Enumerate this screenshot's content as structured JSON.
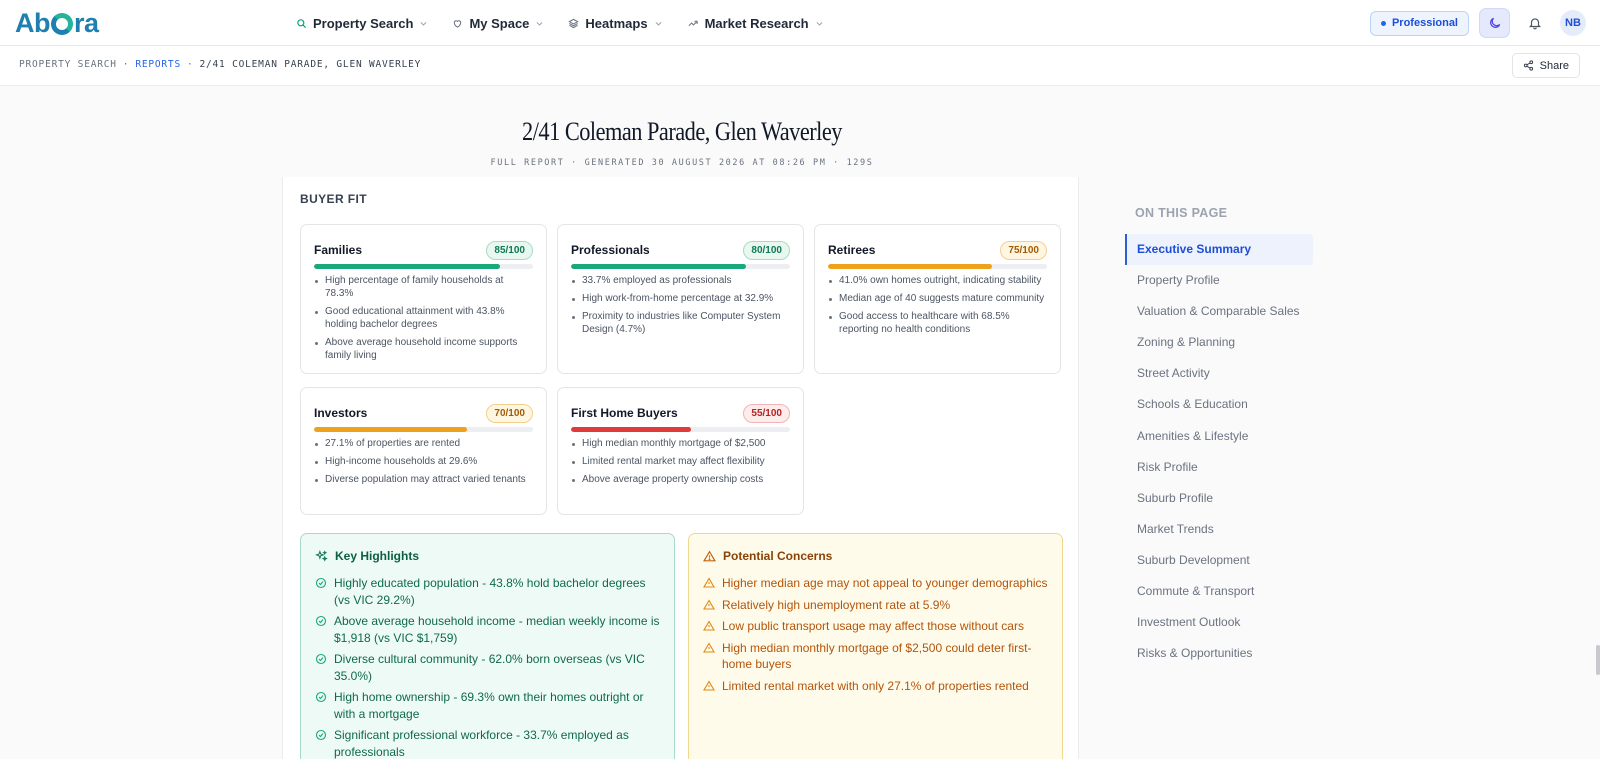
{
  "app": {
    "logo": [
      "Ab",
      "ra"
    ]
  },
  "nav": [
    {
      "label": "Property Search",
      "icon": "search-icon"
    },
    {
      "label": "My Space",
      "icon": "heart-icon"
    },
    {
      "label": "Heatmaps",
      "icon": "layers-icon"
    },
    {
      "label": "Market Research",
      "icon": "trending-icon"
    }
  ],
  "header": {
    "plan": "Professional",
    "avatar": "NB"
  },
  "breadcrumb": {
    "root": "PROPERTY SEARCH",
    "sep": "·",
    "reports": "REPORTS",
    "current": "2/41 COLEMAN PARADE, GLEN WAVERLEY"
  },
  "share_label": "Share",
  "report": {
    "title": "2/41 Coleman Parade, Glen Waverley",
    "subtitle": "FULL REPORT · GENERATED 30 AUGUST 2026 AT 08:26 PM · 129S"
  },
  "buyer_fit": {
    "title": "BUYER FIT",
    "cards": [
      {
        "name": "Families",
        "score": "85/100",
        "fraction": 0.85,
        "tone": "green",
        "points": [
          "High percentage of family households at 78.3%",
          "Good educational attainment with 43.8% holding bachelor degrees",
          "Above average household income supports family living"
        ]
      },
      {
        "name": "Professionals",
        "score": "80/100",
        "fraction": 0.8,
        "tone": "green",
        "points": [
          "33.7% employed as professionals",
          "High work-from-home percentage at 32.9%",
          "Proximity to industries like Computer System Design (4.7%)"
        ]
      },
      {
        "name": "Retirees",
        "score": "75/100",
        "fraction": 0.75,
        "tone": "amber",
        "points": [
          "41.0% own homes outright, indicating stability",
          "Median age of 40 suggests mature community",
          "Good access to healthcare with 68.5% reporting no health conditions"
        ]
      },
      {
        "name": "Investors",
        "score": "70/100",
        "fraction": 0.7,
        "tone": "amber",
        "points": [
          "27.1% of properties are rented",
          "High-income households at 29.6%",
          "Diverse population may attract varied tenants"
        ]
      },
      {
        "name": "First Home Buyers",
        "score": "55/100",
        "fraction": 0.55,
        "tone": "red",
        "points": [
          "High median monthly mortgage of $2,500",
          "Limited rental market may affect flexibility",
          "Above average property ownership costs"
        ]
      }
    ]
  },
  "highlights": {
    "title": "Key Highlights",
    "items": [
      "Highly educated population - 43.8% hold bachelor degrees (vs VIC 29.2%)",
      "Above average household income - median weekly income is $1,918 (vs VIC $1,759)",
      "Diverse cultural community - 62.0% born overseas (vs VIC 35.0%)",
      "High home ownership - 69.3% own their homes outright or with a mortgage",
      "Significant professional workforce - 33.7% employed as professionals"
    ]
  },
  "concerns": {
    "title": "Potential Concerns",
    "items": [
      "Higher median age may not appeal to younger demographics",
      "Relatively high unemployment rate at 5.9%",
      "Low public transport usage may affect those without cars",
      "High median monthly mortgage of $2,500 could deter first-home buyers",
      "Limited rental market with only 27.1% of properties rented"
    ]
  },
  "toc": {
    "title": "ON THIS PAGE",
    "active": 0,
    "items": [
      "Executive Summary",
      "Property Profile",
      "Valuation & Comparable Sales",
      "Zoning & Planning",
      "Street Activity",
      "Schools & Education",
      "Amenities & Lifestyle",
      "Risk Profile",
      "Suburb Profile",
      "Market Trends",
      "Suburb Development",
      "Commute & Transport",
      "Investment Outlook",
      "Risks & Opportunities"
    ]
  },
  "colors": {
    "brand": "#1e7fb0",
    "accent": "#2563eb",
    "positive": "#19a87a",
    "warning": "#eea21c",
    "danger": "#df3b3b"
  }
}
